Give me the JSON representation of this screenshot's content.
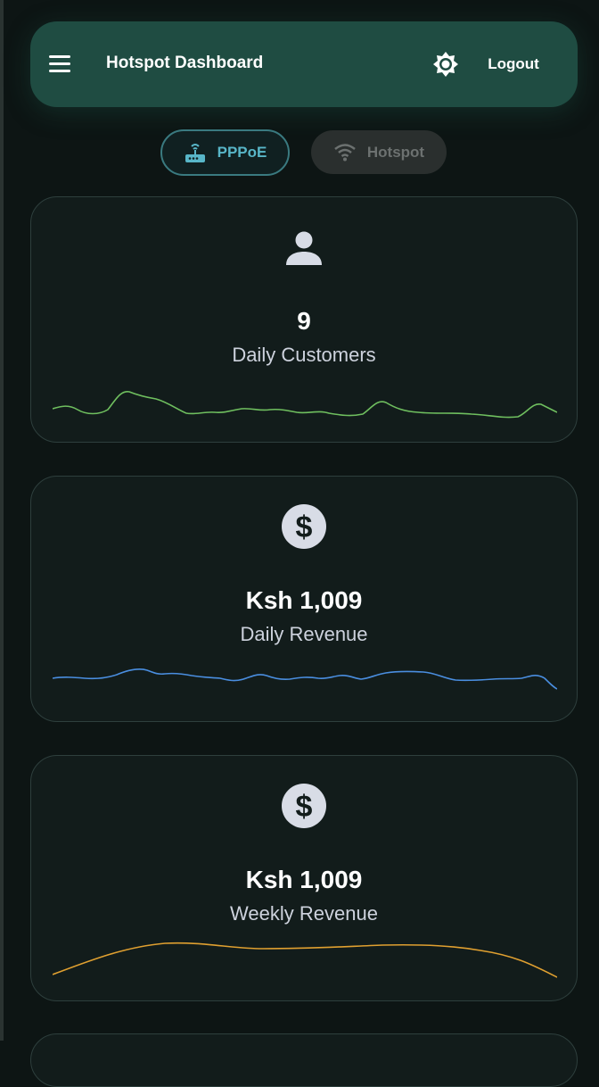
{
  "header": {
    "title": "Hotspot Dashboard",
    "logout_label": "Logout",
    "background": "#1f4c42"
  },
  "tabs": [
    {
      "label": "PPPoE",
      "icon": "router-icon",
      "active": true,
      "color": "#58b6c8"
    },
    {
      "label": "Hotspot",
      "icon": "wifi-icon",
      "active": false,
      "color": "#6c7170"
    }
  ],
  "cards": [
    {
      "icon": "person-icon",
      "value": "9",
      "label": "Daily Customers",
      "sparkline_color": "#6fbf5f"
    },
    {
      "icon": "dollar-icon",
      "value": "Ksh 1,009",
      "label": "Daily Revenue",
      "sparkline_color": "#4a8ee0"
    },
    {
      "icon": "dollar-icon",
      "value": "Ksh 1,009",
      "label": "Weekly Revenue",
      "sparkline_color": "#e0a030"
    }
  ]
}
